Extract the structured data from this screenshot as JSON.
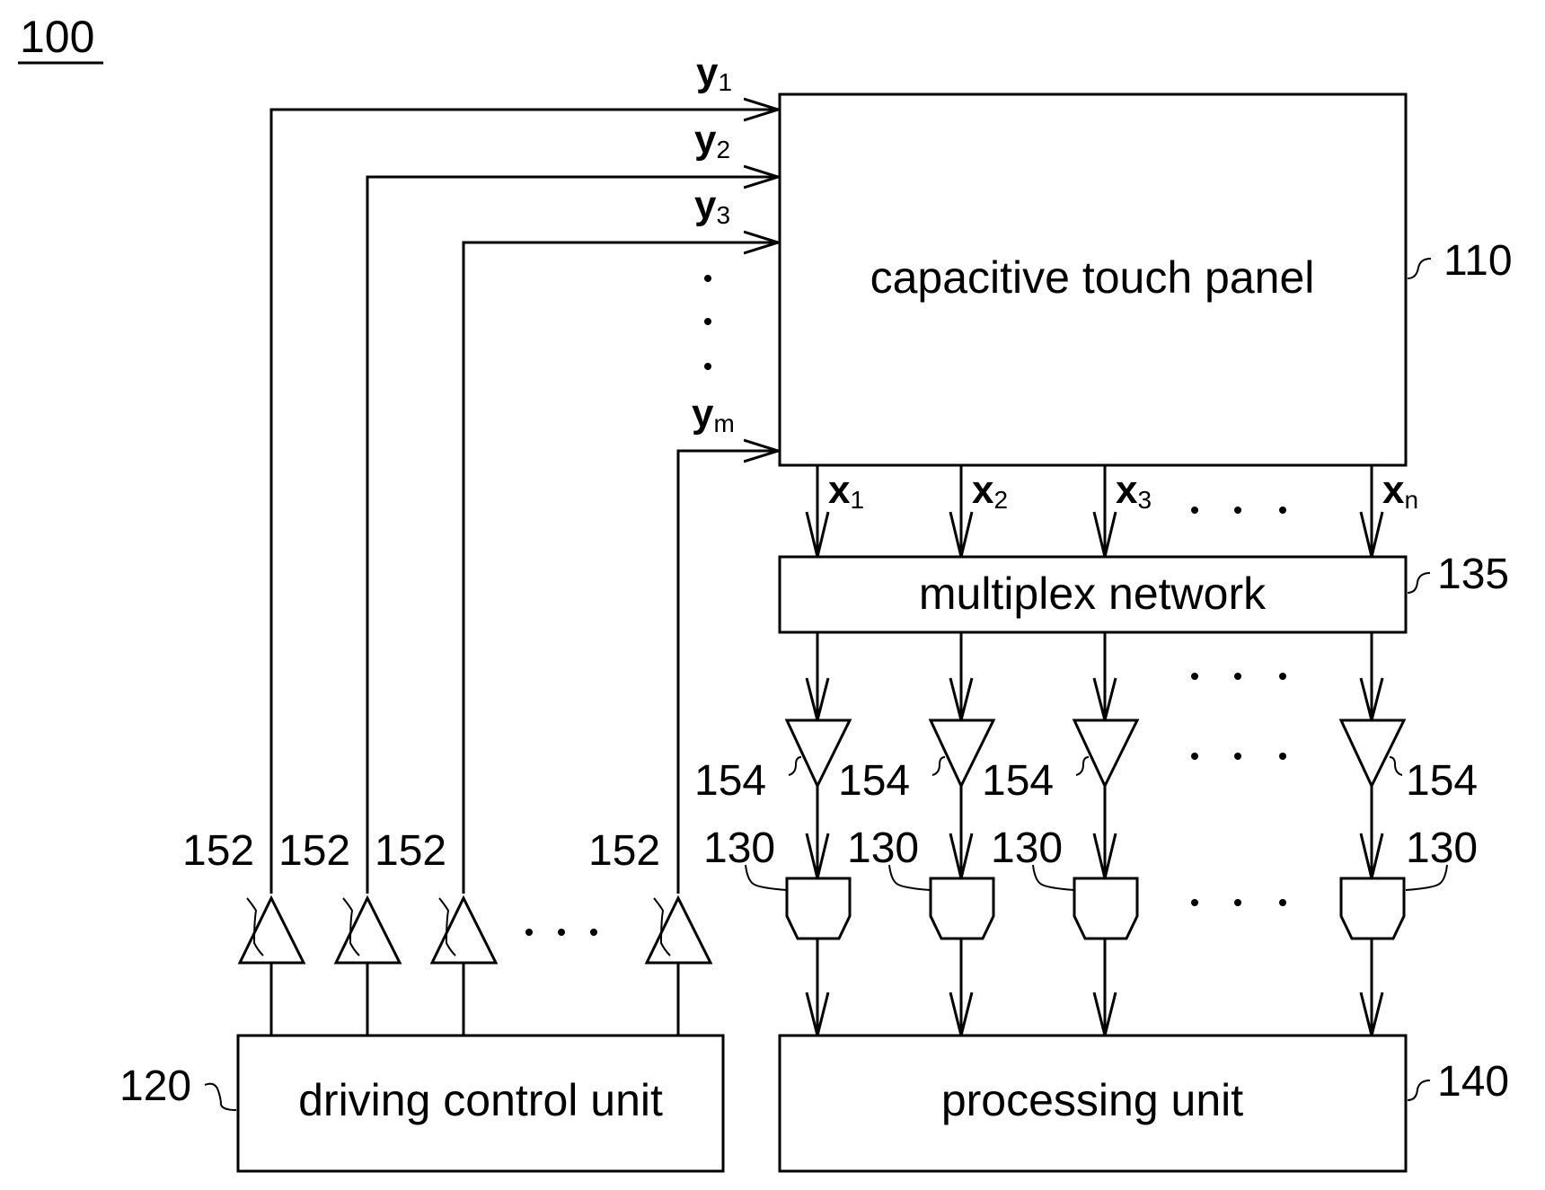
{
  "figure": {
    "label": "100"
  },
  "blocks": {
    "panel": {
      "label": "capacitive touch panel",
      "ref": "110"
    },
    "mux": {
      "label": "multiplex network",
      "ref": "135"
    },
    "driver": {
      "label": "driving control unit",
      "ref": "120"
    },
    "processor": {
      "label": "processing unit",
      "ref": "140"
    }
  },
  "drive_lines": [
    {
      "name": "y",
      "sub": "1"
    },
    {
      "name": "y",
      "sub": "2"
    },
    {
      "name": "y",
      "sub": "3"
    },
    {
      "name": "y",
      "sub": "m"
    }
  ],
  "sense_lines": [
    {
      "name": "x",
      "sub": "1"
    },
    {
      "name": "x",
      "sub": "2"
    },
    {
      "name": "x",
      "sub": "3"
    },
    {
      "name": "x",
      "sub": "n"
    }
  ],
  "drive_buffers": {
    "ref": "152",
    "count_shown": 4
  },
  "sense_amplifiers": {
    "ref": "154",
    "count_shown": 4
  },
  "adcs": {
    "ref": "130",
    "count_shown": 4
  },
  "ellipsis": "· · ·"
}
